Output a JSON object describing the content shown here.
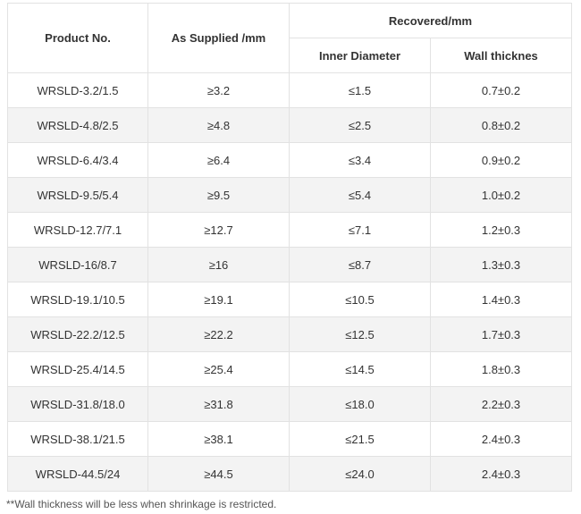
{
  "table": {
    "headers": {
      "product_no": "Product No.",
      "as_supplied": "As Supplied /mm",
      "recovered": "Recovered/mm",
      "inner_diameter": "Inner Diameter",
      "wall_thickness": "Wall thicknes"
    },
    "rows": [
      {
        "product": "WRSLD-3.2/1.5",
        "supplied": "≥3.2",
        "inner": "≤1.5",
        "wall": "0.7±0.2"
      },
      {
        "product": "WRSLD-4.8/2.5",
        "supplied": "≥4.8",
        "inner": "≤2.5",
        "wall": "0.8±0.2"
      },
      {
        "product": "WRSLD-6.4/3.4",
        "supplied": "≥6.4",
        "inner": "≤3.4",
        "wall": "0.9±0.2"
      },
      {
        "product": "WRSLD-9.5/5.4",
        "supplied": "≥9.5",
        "inner": "≤5.4",
        "wall": "1.0±0.2"
      },
      {
        "product": "WRSLD-12.7/7.1",
        "supplied": "≥12.7",
        "inner": "≤7.1",
        "wall": "1.2±0.3"
      },
      {
        "product": "WRSLD-16/8.7",
        "supplied": "≥16",
        "inner": "≤8.7",
        "wall": "1.3±0.3"
      },
      {
        "product": "WRSLD-19.1/10.5",
        "supplied": "≥19.1",
        "inner": "≤10.5",
        "wall": "1.4±0.3"
      },
      {
        "product": "WRSLD-22.2/12.5",
        "supplied": "≥22.2",
        "inner": "≤12.5",
        "wall": "1.7±0.3"
      },
      {
        "product": "WRSLD-25.4/14.5",
        "supplied": "≥25.4",
        "inner": "≤14.5",
        "wall": "1.8±0.3"
      },
      {
        "product": "WRSLD-31.8/18.0",
        "supplied": "≥31.8",
        "inner": "≤18.0",
        "wall": "2.2±0.3"
      },
      {
        "product": "WRSLD-38.1/21.5",
        "supplied": "≥38.1",
        "inner": "≤21.5",
        "wall": "2.4±0.3"
      },
      {
        "product": "WRSLD-44.5/24",
        "supplied": "≥44.5",
        "inner": "≤24.0",
        "wall": "2.4±0.3"
      }
    ]
  },
  "footnote": "**Wall thickness will be less when shrinkage is restricted."
}
